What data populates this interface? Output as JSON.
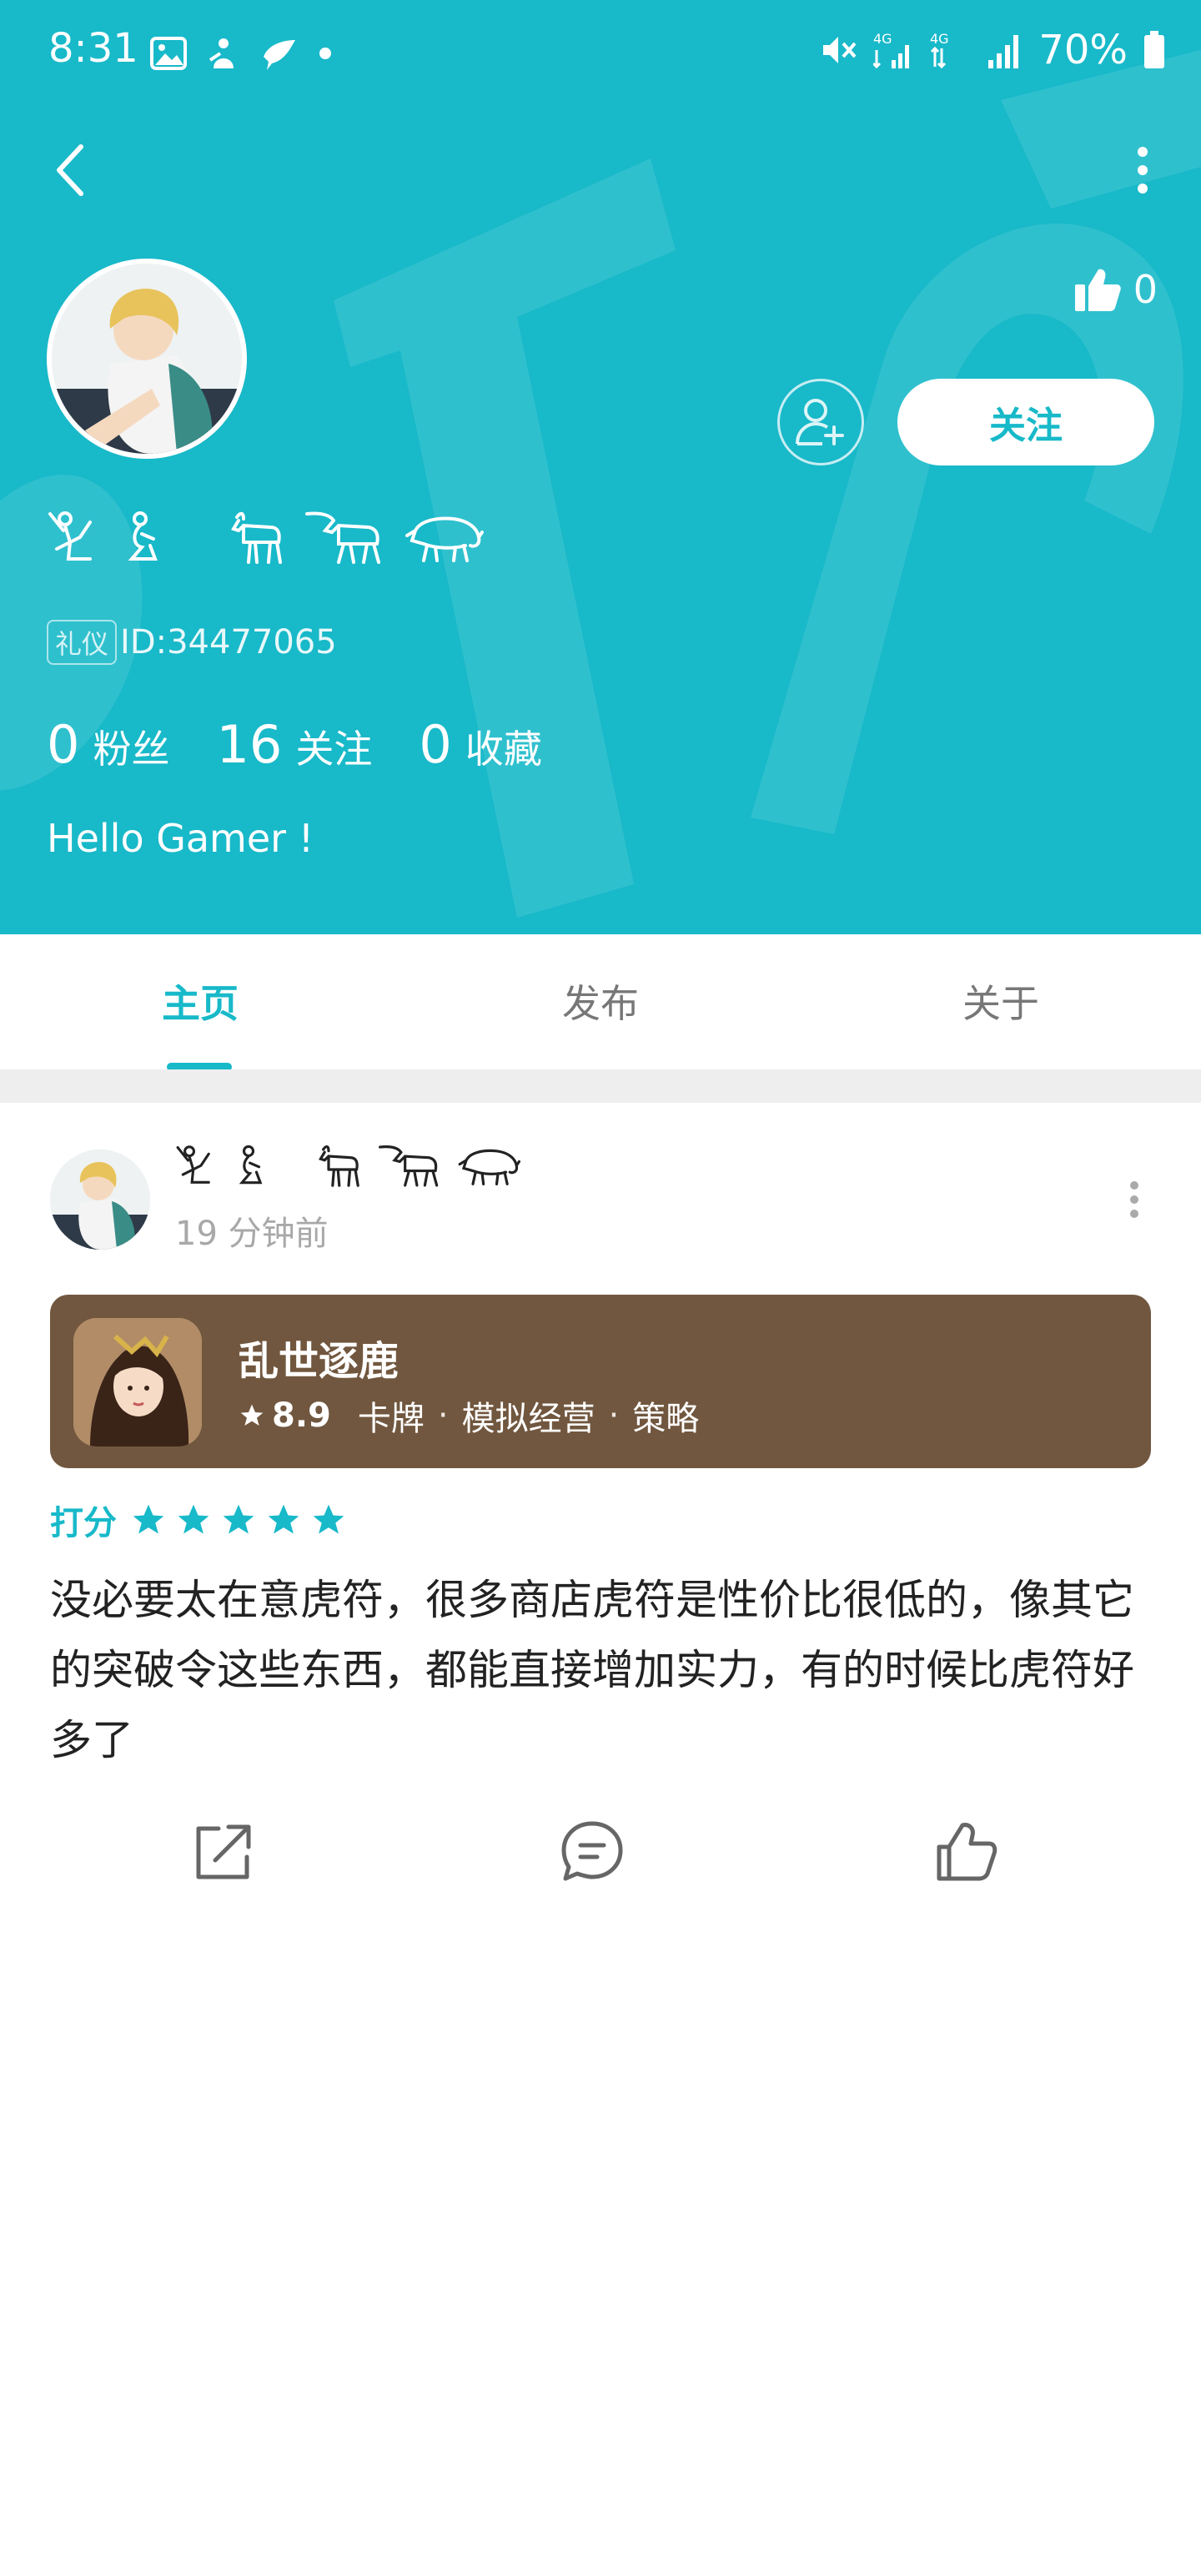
{
  "status_bar": {
    "time": "8:31",
    "battery_text": "70%",
    "left_icons": [
      "image-icon",
      "app-notification-icon",
      "bird-notification-icon",
      "dot-icon"
    ],
    "right_icons": [
      "mute-icon",
      "4g-signal-icon",
      "4g-signal-icon",
      "signal-icon",
      "battery-icon"
    ]
  },
  "header": {
    "background_color": "#18b9c9",
    "like_count": "0",
    "follow_label": "关注",
    "username_glyphs": [
      "𓀡",
      "𓀀",
      "𓃘",
      "𓃶",
      "𓃟"
    ],
    "badge": "礼仪",
    "user_id": "ID:34477065",
    "stats": [
      {
        "value": "0",
        "label": "粉丝"
      },
      {
        "value": "16",
        "label": "关注"
      },
      {
        "value": "0",
        "label": "收藏"
      }
    ],
    "bio": "Hello Gamer !"
  },
  "tabs": [
    {
      "label": "主页",
      "active": true
    },
    {
      "label": "发布",
      "active": false
    },
    {
      "label": "关于",
      "active": false
    }
  ],
  "post": {
    "username_glyphs": [
      "𓀡",
      "𓀀",
      "𓃘",
      "𓃶",
      "𓃟"
    ],
    "time": "19 分钟前",
    "game": {
      "title": "乱世逐鹿",
      "score": "8.9",
      "tags": [
        "卡牌",
        "模拟经营",
        "策略"
      ],
      "card_color": "#71573f"
    },
    "rating_label": "打分",
    "rating_stars": 5,
    "content": "没必要太在意虎符，很多商店虎符是性价比很低的，像其它的突破令这些东西，都能直接增加实力，有的时候比虎符好多了",
    "actions": [
      "share-icon",
      "comment-icon",
      "thumbs-up-icon"
    ]
  }
}
